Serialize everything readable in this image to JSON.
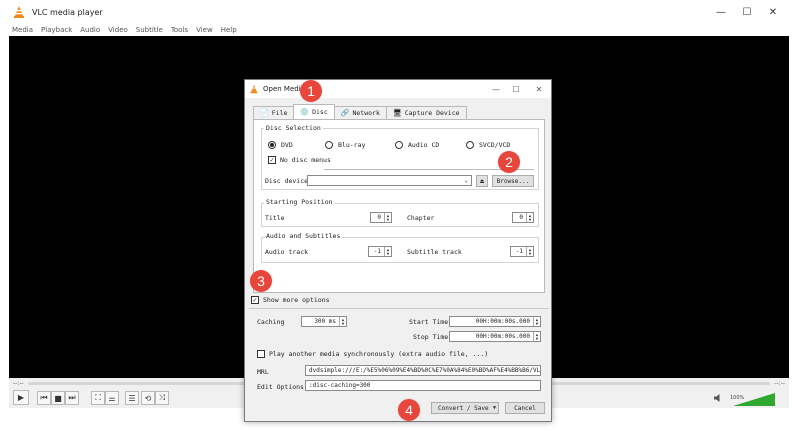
{
  "window": {
    "title": "VLC media player",
    "minimize": "—",
    "maximize": "☐",
    "close": "✕"
  },
  "menu": [
    "Media",
    "Playback",
    "Audio",
    "Video",
    "Subtitle",
    "Tools",
    "View",
    "Help"
  ],
  "player": {
    "time_left": "--:--",
    "time_right": "--:--",
    "volume_pct": "100%"
  },
  "dialog": {
    "title": "Open Media",
    "tabs": [
      {
        "icon": "📄",
        "label": "File"
      },
      {
        "icon": "💿",
        "label": "Disc"
      },
      {
        "icon": "🔗",
        "label": "Network"
      },
      {
        "icon": "🖥",
        "label": "Capture Device"
      }
    ],
    "disc_selection": {
      "title": "Disc Selection",
      "options": [
        "DVD",
        "Blu-ray",
        "Audio CD",
        "SVCD/VCD"
      ],
      "selected": "DVD",
      "no_disc_menus": "No disc menus",
      "disc_device_label": "Disc device",
      "disc_device_value": "",
      "browse": "Browse..."
    },
    "starting_position": {
      "title": "Starting Position",
      "title_label": "Title",
      "title_value": "0",
      "chapter_label": "Chapter",
      "chapter_value": "0"
    },
    "audio_subtitles": {
      "title": "Audio and Subtitles",
      "audio_track_label": "Audio track",
      "audio_track_value": "-1",
      "subtitle_track_label": "Subtitle track",
      "subtitle_track_value": "-1"
    },
    "show_more": "Show more options",
    "caching_label": "Caching",
    "caching_value": "300 ms",
    "start_time_label": "Start Time",
    "start_time_value": "00H:00m:00s.000",
    "stop_time_label": "Stop Time",
    "stop_time_value": "00H:00m:00s.000",
    "play_another": "Play another media synchronously (extra audio file, ...)",
    "mrl_label": "MRL",
    "mrl_value": "dvdsimple:///E:/%E5%06%09%E4%BD%0C%E7%0A%84%E0%BD%AF%E4%BB%B6/VLC/",
    "edit_options_label": "Edit Options",
    "edit_options_value": ":disc-caching=300",
    "convert_save": "Convert / Save",
    "cancel": "Cancel"
  },
  "badges": [
    "1",
    "2",
    "3",
    "4"
  ],
  "colors": {
    "badge": "#e8453c",
    "video": "#000000",
    "volume": "#2ea82e"
  }
}
